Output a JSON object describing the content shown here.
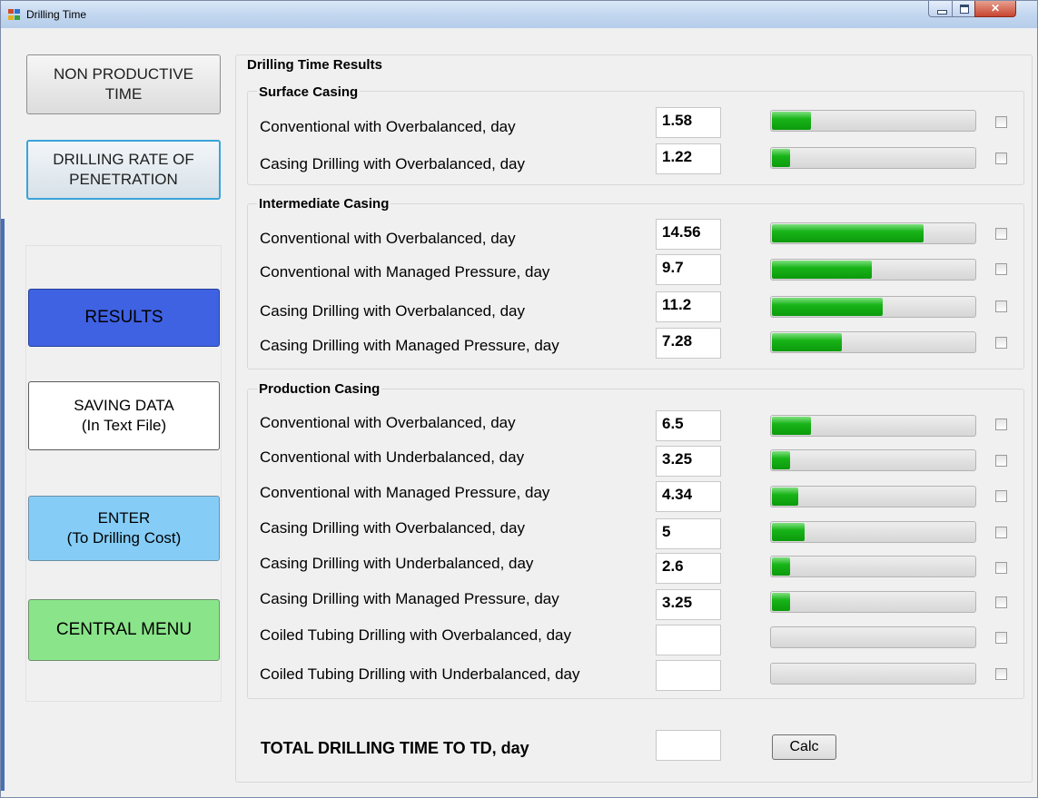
{
  "window": {
    "title": "Drilling Time"
  },
  "nav": {
    "non_productive": "NON PRODUCTIVE\nTIME",
    "drilling_rop": "DRILLING RATE OF\nPENETRATION",
    "results": "RESULTS",
    "saving": "SAVING DATA\n(In Text File)",
    "enter": "ENTER\n(To Drilling Cost)",
    "central": "CENTRAL MENU"
  },
  "results": {
    "title": "Drilling Time Results",
    "surface": {
      "title": "Surface Casing",
      "rows": [
        {
          "label": "Conventional with Overbalanced, day",
          "value": "1.58",
          "progress": 0.19
        },
        {
          "label": "Casing Drilling with Overbalanced, day",
          "value": "1.22",
          "progress": 0.09
        }
      ]
    },
    "intermediate": {
      "title": "Intermediate Casing",
      "rows": [
        {
          "label": "Conventional with Overbalanced, day",
          "value": "14.56",
          "progress": 0.74
        },
        {
          "label": "Conventional with Managed Pressure, day",
          "value": "9.7",
          "progress": 0.49
        },
        {
          "label": "Casing Drilling with Overbalanced, day",
          "value": "11.2",
          "progress": 0.54
        },
        {
          "label": "Casing Drilling with Managed Pressure, day",
          "value": "7.28",
          "progress": 0.34
        }
      ]
    },
    "production": {
      "title": "Production Casing",
      "rows": [
        {
          "label": "Conventional with Overbalanced, day",
          "value": "6.5",
          "progress": 0.19
        },
        {
          "label": "Conventional with Underbalanced, day",
          "value": "3.25",
          "progress": 0.09
        },
        {
          "label": "Conventional with Managed Pressure, day",
          "value": "4.34",
          "progress": 0.13
        },
        {
          "label": "Casing Drilling with Overbalanced, day",
          "value": "5",
          "progress": 0.16
        },
        {
          "label": "Casing Drilling with Underbalanced, day",
          "value": "2.6",
          "progress": 0.09
        },
        {
          "label": "Casing Drilling with Managed Pressure, day",
          "value": "3.25",
          "progress": 0.09
        },
        {
          "label": "Coiled Tubing Drilling with Overbalanced, day",
          "value": "",
          "progress": 0
        },
        {
          "label": "Coiled Tubing Drilling with Underbalanced, day",
          "value": "",
          "progress": 0
        }
      ]
    },
    "total_label": "TOTAL DRILLING TIME TO TD, day",
    "total_value": "",
    "calc_label": "Calc"
  }
}
